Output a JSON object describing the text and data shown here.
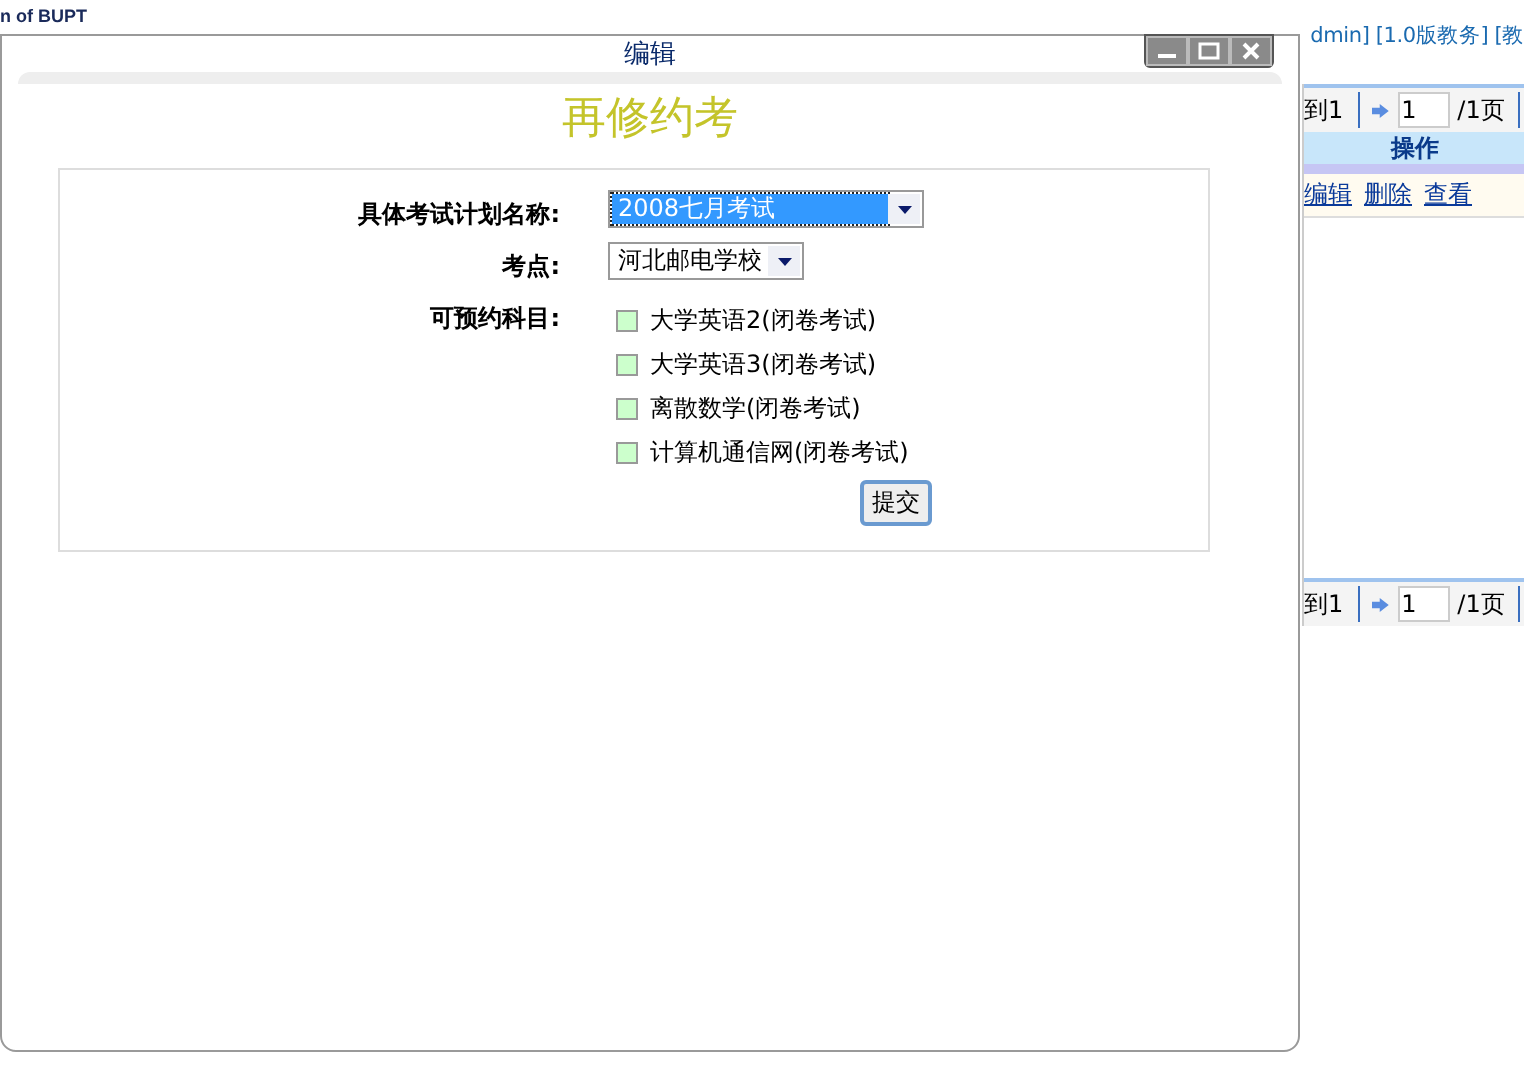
{
  "background_page": {
    "logo_text": "n of BUPT",
    "top_links": "dmin] [1.0版教务] [教",
    "pager_top": {
      "label": "到1",
      "page_input": "1",
      "total": "/1页"
    },
    "column_header": "操作",
    "row_actions": [
      "编辑",
      "删除",
      "查看"
    ],
    "pager_bottom": {
      "label": "到1",
      "page_input": "1",
      "total": "/1页"
    }
  },
  "dialog": {
    "title": "编辑",
    "heading": "再修约考",
    "fields": [
      {
        "kind": "select",
        "label": "具体考试计划名称:",
        "value": "2008七月考试",
        "focused": true
      },
      {
        "kind": "select",
        "label": "考点:",
        "value": "河北邮电学校",
        "focused": false
      },
      {
        "kind": "checklist",
        "label": "可预约科目:",
        "options": [
          {
            "label": "大学英语2(闭卷考试)",
            "checked": false
          },
          {
            "label": "大学英语3(闭卷考试)",
            "checked": false
          },
          {
            "label": "离散数学(闭卷考试)",
            "checked": false
          },
          {
            "label": "计算机通信网(闭卷考试)",
            "checked": false
          }
        ]
      }
    ],
    "submit": "提交"
  }
}
